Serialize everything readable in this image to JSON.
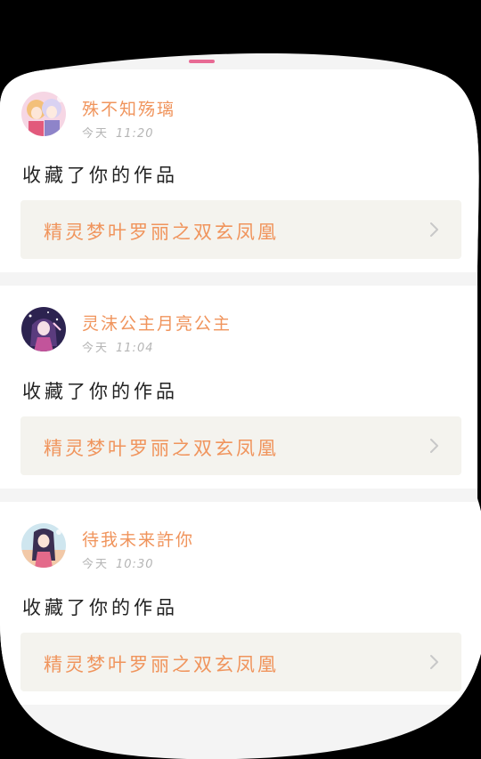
{
  "colors": {
    "accent": "#f0945c",
    "indicator": "#e86a94",
    "chevron": "#c8c8c8"
  },
  "notifications": [
    {
      "username": "殊不知殇璃",
      "date_label": "今天",
      "time": "11:20",
      "action": "收藏了你的作品",
      "work_title": "精灵梦叶罗丽之双玄凤凰",
      "avatar_icon": "anime-girls-avatar"
    },
    {
      "username": "灵沫公主月亮公主",
      "date_label": "今天",
      "time": "11:04",
      "action": "收藏了你的作品",
      "work_title": "精灵梦叶罗丽之双玄凤凰",
      "avatar_icon": "anime-princess-avatar"
    },
    {
      "username": "待我未来許你",
      "date_label": "今天",
      "time": "10:30",
      "action": "收藏了你的作品",
      "work_title": "精灵梦叶罗丽之双玄凤凰",
      "avatar_icon": "anime-girl-avatar"
    }
  ]
}
